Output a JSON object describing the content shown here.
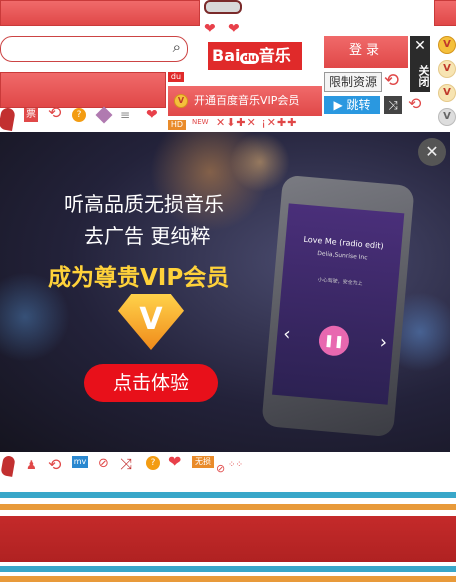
{
  "header": {
    "logo_text": "Bai",
    "logo_paw": "du",
    "logo_music": "音乐",
    "login_label": "登录",
    "close_side_label": "关闭",
    "restrict_label": "限制资源",
    "jump_label": "跳转",
    "du_badge": "du",
    "vip_open_label": "开通百度音乐VIP会员",
    "hd_badge": "HD",
    "new_badge": "NEW",
    "ticket_badge": "票"
  },
  "search": {
    "placeholder": ""
  },
  "banner": {
    "line1": "听高品质无损音乐",
    "line2": "去广告 更纯粹",
    "line3": "成为尊贵VIP会员",
    "cta_label": "点击体验",
    "song_title": "Love Me (radio edit)",
    "song_artist": "Delia,Sunrise Inc",
    "lyric": "小心驾驶，安全为上"
  },
  "bottom": {
    "mv_badge": "mv",
    "lossless_badge": "无损"
  },
  "colors": {
    "accent": "#e04848",
    "banner_bg": "#23223a",
    "gold": "#f5c03c",
    "cta": "#e8101a"
  }
}
